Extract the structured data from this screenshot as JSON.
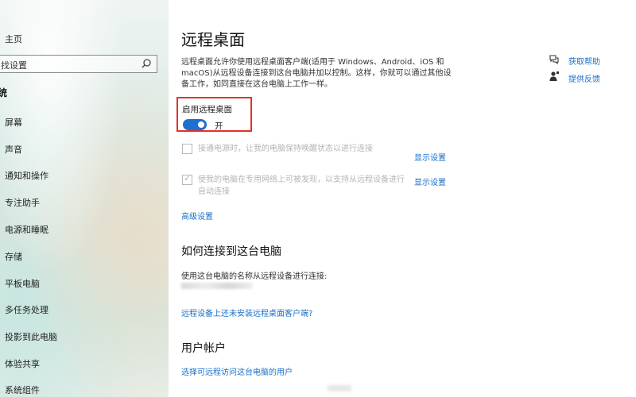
{
  "sidebar": {
    "home": "主页",
    "search_placeholder": "找设置",
    "section": "统",
    "items": [
      {
        "label": "屏幕"
      },
      {
        "label": "声音"
      },
      {
        "label": "通知和操作"
      },
      {
        "label": "专注助手"
      },
      {
        "label": "电源和睡眠"
      },
      {
        "label": "存储"
      },
      {
        "label": "平板电脑"
      },
      {
        "label": "多任务处理"
      },
      {
        "label": "投影到此电脑"
      },
      {
        "label": "体验共享"
      },
      {
        "label": "系统组件"
      }
    ]
  },
  "main": {
    "title": "远程桌面",
    "description": "远程桌面允许你使用远程桌面客户端(适用于 Windows、Android、iOS 和 macOS)从远程设备连接到这台电脑并加以控制。这样，你就可以通过其他设备工作，如同直接在这台电脑上工作一样。",
    "enable_label": "启用远程桌面",
    "toggle_state": "开",
    "option1": "接通电源时，让我的电脑保持唤醒状态以进行连接",
    "option1_link": "显示设置",
    "option2": "使我的电脑在专用网络上可被发现，以支持从远程设备进行自动连接",
    "option2_link": "显示设置",
    "advanced": "高级设置",
    "how_title": "如何连接到这台电脑",
    "how_desc": "使用这台电脑的名称从远程设备进行连接:",
    "client_link": "远程设备上还未安装远程桌面客户端?",
    "accounts_title": "用户帐户",
    "accounts_link": "选择可远程访问这台电脑的用户"
  },
  "help": {
    "get_help": "获取帮助",
    "feedback": "提供反馈"
  },
  "colors": {
    "accent": "#1e6fd0",
    "link": "#1a6fc8",
    "highlight_box": "#e4322b"
  }
}
